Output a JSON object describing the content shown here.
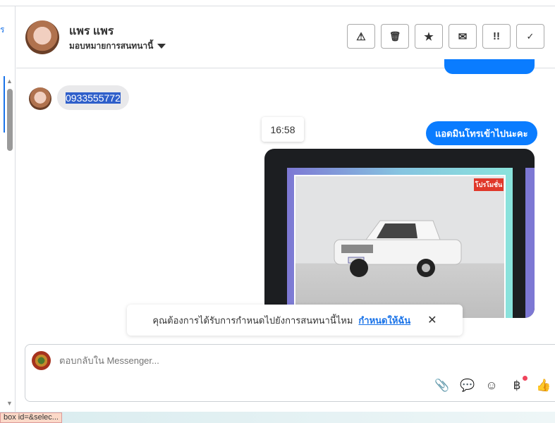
{
  "sidebar": {
    "edge_glyph": "ร"
  },
  "header": {
    "name": "แพร แพร",
    "assign_label": "มอบหมายการสนทนานี้",
    "actions": [
      {
        "name": "spam",
        "icon": "warning-icon",
        "glyph": "⚠"
      },
      {
        "name": "delete",
        "icon": "trash-icon",
        "glyph": "🗑"
      },
      {
        "name": "star",
        "icon": "star-icon",
        "glyph": "★"
      },
      {
        "name": "mark-unread",
        "icon": "envelope-icon",
        "glyph": "✉"
      },
      {
        "name": "follow-up",
        "icon": "exclamation-icon",
        "glyph": "!!"
      },
      {
        "name": "done",
        "icon": "check-icon",
        "glyph": "✓"
      }
    ]
  },
  "messages": {
    "incoming_text": "0933555772",
    "timestamp": "16:58",
    "outgoing_text": "แอดมินโทรเข้าไปนะคะ",
    "image_badge": "โปรโมชั่น"
  },
  "toast": {
    "text": "คุณต้องการได้รับการกำหนดไปยังการสนทนานี้ไหม",
    "link": "กำหนดให้ฉัน",
    "close": "✕"
  },
  "composer": {
    "placeholder": "ตอบกลับใน Messenger...",
    "icons": [
      "paperclip-icon",
      "chat-bubble-icon",
      "emoji-icon",
      "baht-icon",
      "thumbs-up-icon"
    ],
    "glyphs": [
      "📎",
      "💬",
      "☺",
      "฿",
      "👍"
    ]
  },
  "status": {
    "tooltip": "box id=&selec..."
  },
  "colors": {
    "accent": "#0a7cff",
    "selection": "#2f5fca"
  }
}
